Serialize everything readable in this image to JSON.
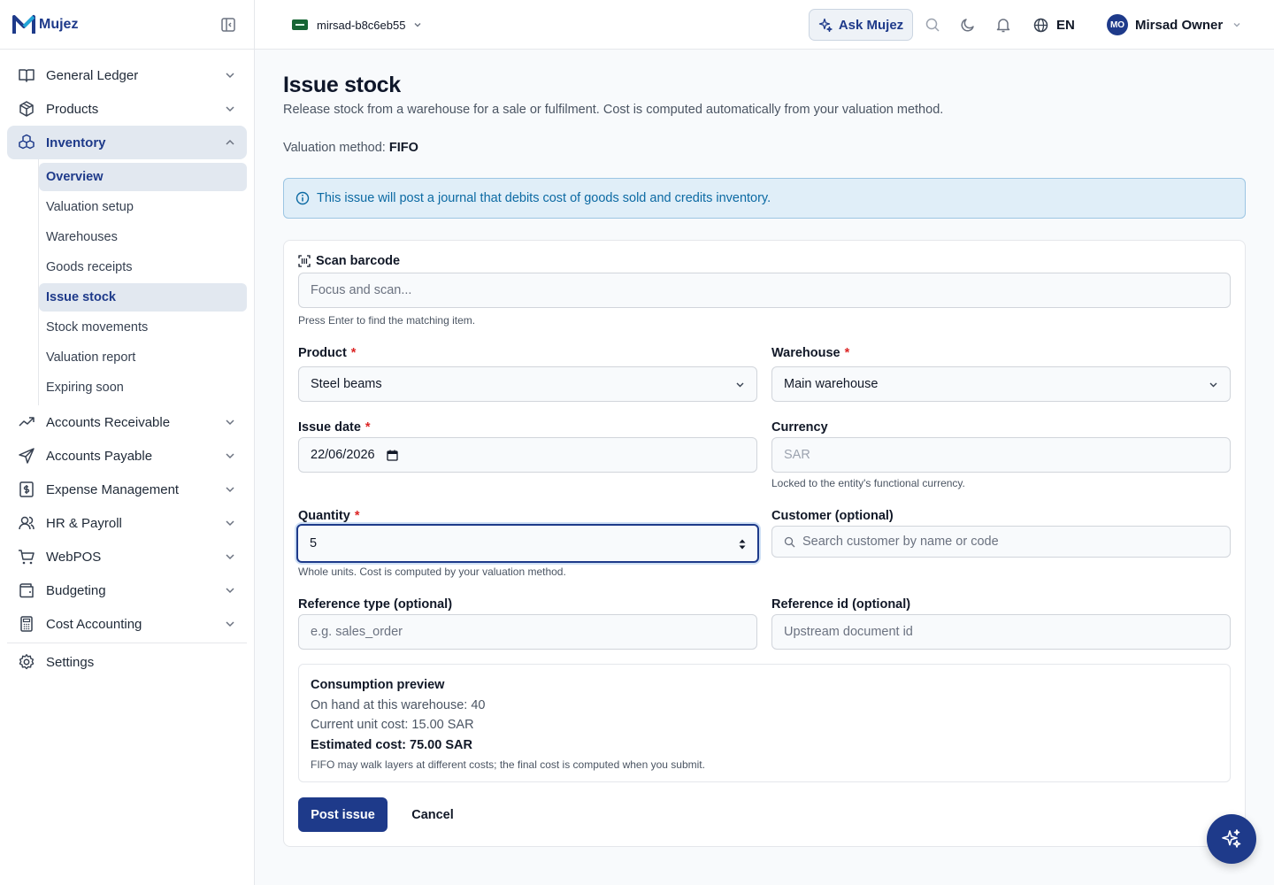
{
  "brand": {
    "name": "Mujez"
  },
  "sidebar": {
    "items": [
      {
        "label": "General Ledger"
      },
      {
        "label": "Products"
      },
      {
        "label": "Inventory"
      },
      {
        "label": "Accounts Receivable"
      },
      {
        "label": "Accounts Payable"
      },
      {
        "label": "Expense Management"
      },
      {
        "label": "HR & Payroll"
      },
      {
        "label": "WebPOS"
      },
      {
        "label": "Budgeting"
      },
      {
        "label": "Cost Accounting"
      },
      {
        "label": "Settings"
      }
    ],
    "inventory_sub": [
      {
        "label": "Overview"
      },
      {
        "label": "Valuation setup"
      },
      {
        "label": "Warehouses"
      },
      {
        "label": "Goods receipts"
      },
      {
        "label": "Issue stock"
      },
      {
        "label": "Stock movements"
      },
      {
        "label": "Valuation report"
      },
      {
        "label": "Expiring soon"
      }
    ]
  },
  "topbar": {
    "entity": "mirsad-b8c6eb55",
    "ask_label": "Ask Mujez",
    "language": "EN",
    "user_initials": "MO",
    "user_name": "Mirsad Owner"
  },
  "page": {
    "title": "Issue stock",
    "subtitle": "Release stock from a warehouse for a sale or fulfilment. Cost is computed automatically from your valuation method.",
    "valuation_label": "Valuation method:",
    "valuation_value": "FIFO",
    "alert": "This issue will post a journal that debits cost of goods sold and credits inventory."
  },
  "form": {
    "scan_label": "Scan barcode",
    "scan_placeholder": "Focus and scan...",
    "scan_hint": "Press Enter to find the matching item.",
    "product_label": "Product",
    "product_value": "Steel beams",
    "warehouse_label": "Warehouse",
    "warehouse_value": "Main warehouse",
    "issue_date_label": "Issue date",
    "issue_date_value": "22/06/2026",
    "currency_label": "Currency",
    "currency_value": "SAR",
    "currency_hint": "Locked to the entity's functional currency.",
    "quantity_label": "Quantity",
    "quantity_value": "5",
    "quantity_hint": "Whole units. Cost is computed by your valuation method.",
    "customer_label": "Customer (optional)",
    "customer_placeholder": "Search customer by name or code",
    "ref_type_label": "Reference type (optional)",
    "ref_type_placeholder": "e.g. sales_order",
    "ref_id_label": "Reference id (optional)",
    "ref_id_placeholder": "Upstream document id",
    "required_mark": "*"
  },
  "preview": {
    "title": "Consumption preview",
    "on_hand": "On hand at this warehouse: 40",
    "unit_cost": "Current unit cost: 15.00 SAR",
    "estimated": "Estimated cost: 75.00 SAR",
    "note": "FIFO may walk layers at different costs; the final cost is computed when you submit."
  },
  "actions": {
    "post": "Post issue",
    "cancel": "Cancel"
  },
  "colors": {
    "primary": "#1e3a8a",
    "alert_bg": "#e0eef8",
    "alert_text": "#0c6aa3",
    "required": "#dc2626"
  }
}
